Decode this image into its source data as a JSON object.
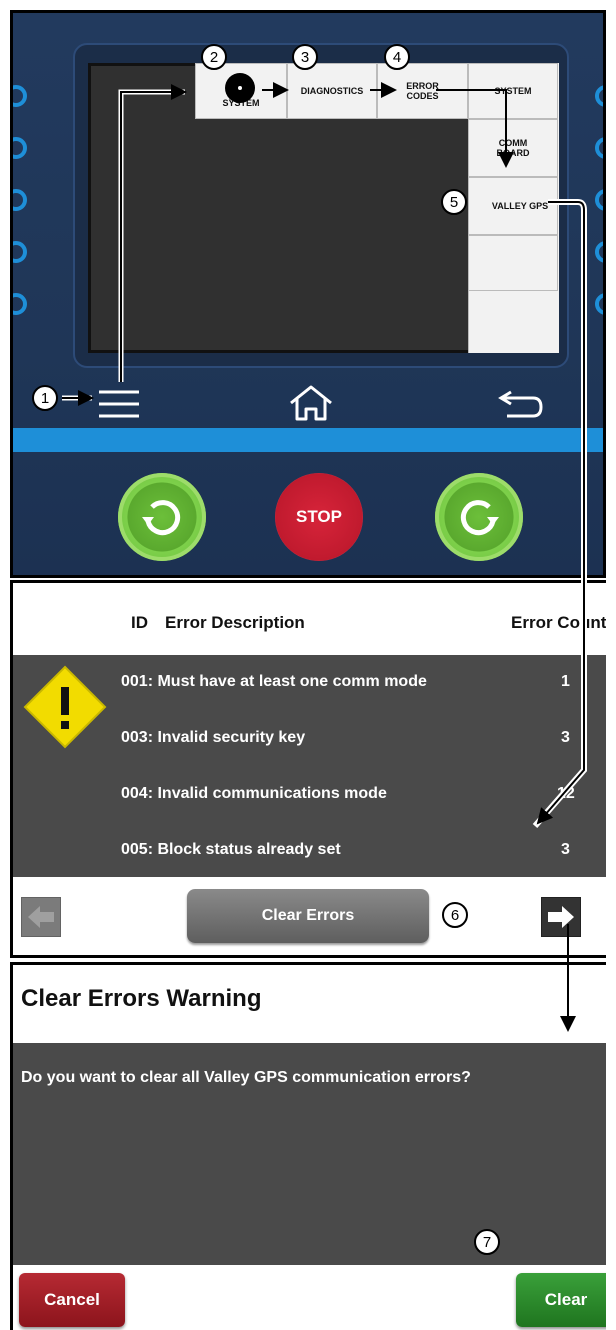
{
  "device": {
    "menu": {
      "system": "SYSTEM",
      "diagnostics": "DIAGNOSTICS",
      "error_codes_line1": "ERROR",
      "error_codes_line2": "CODES",
      "side_system": "SYSTEM",
      "comm_line1": "COMM",
      "comm_line2": "BOARD",
      "valley_gps": "VALLEY GPS"
    },
    "stop_label": "STOP",
    "callouts": [
      "1",
      "2",
      "3",
      "4",
      "5"
    ]
  },
  "errors": {
    "headers": {
      "id": "ID",
      "description": "Error Description",
      "count": "Error Count"
    },
    "rows": [
      {
        "text": "001: Must have at least one comm mode",
        "count": "1"
      },
      {
        "text": "003: Invalid security key",
        "count": "3"
      },
      {
        "text": "004: Invalid communications mode",
        "count": "12"
      },
      {
        "text": "005: Block status already set",
        "count": "3"
      }
    ],
    "clear_button": "Clear Errors",
    "callout": "6"
  },
  "warning": {
    "title": "Clear Errors Warning",
    "message": "Do you want to clear all Valley GPS communication errors?",
    "cancel": "Cancel",
    "clear": "Clear",
    "callout": "7"
  },
  "colors": {
    "accent_blue": "#1e8fd8",
    "green": "#2f8a2f",
    "red": "#a01a22",
    "panel_gray": "#4a4a4a"
  }
}
